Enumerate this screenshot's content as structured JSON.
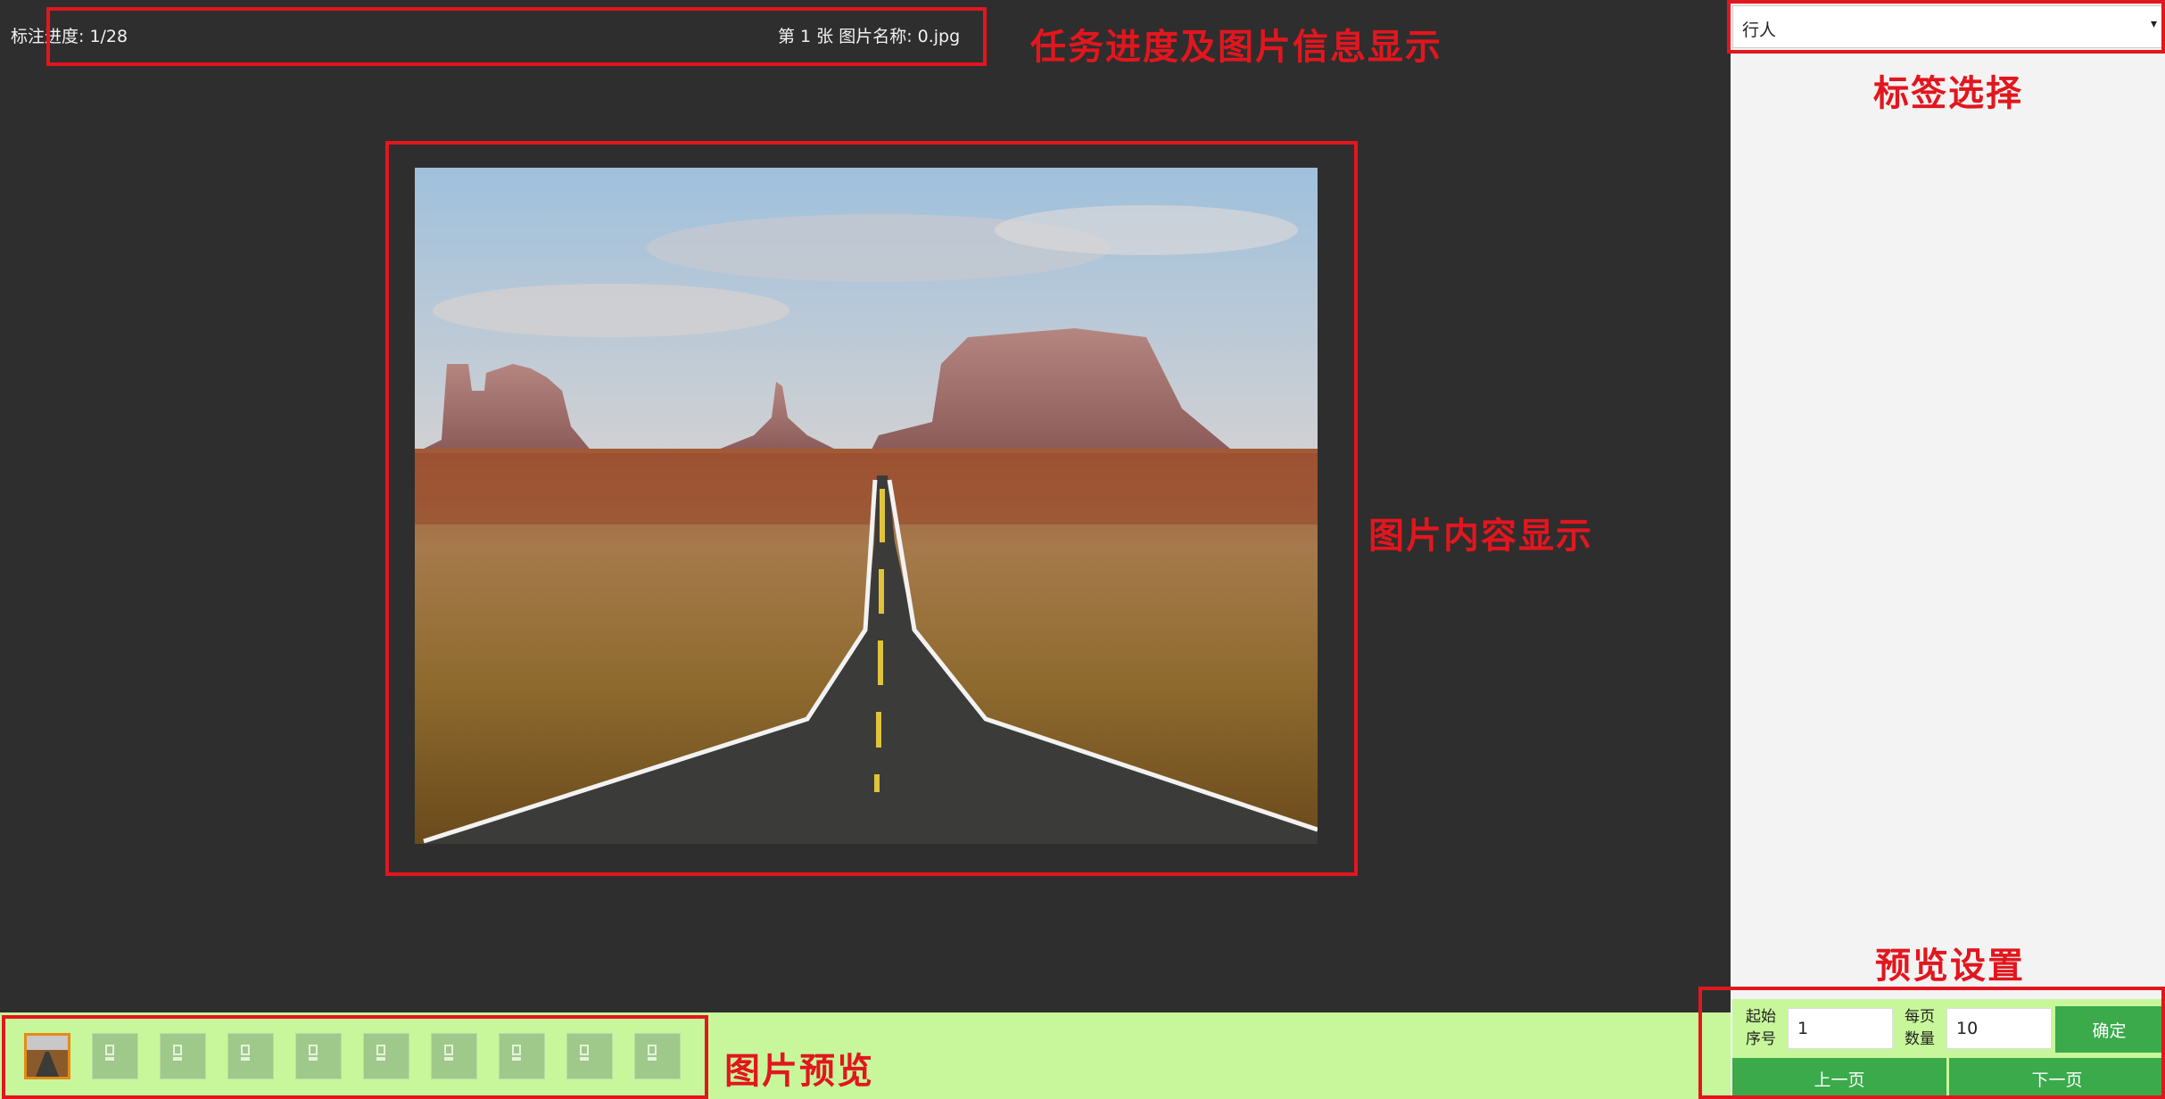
{
  "header": {
    "progress": "标注进度: 1/28",
    "image_info": "第 1 张 图片名称: 0.jpg"
  },
  "label_select": {
    "selected": "行人",
    "caret": "▾"
  },
  "preview": {
    "thumbnail_count": 10,
    "active_index": 0
  },
  "settings": {
    "start_label": "起始\n序号",
    "start_value": "1",
    "per_page_label": "每页\n数量",
    "per_page_value": "10",
    "confirm": "确定",
    "prev_page": "上一页",
    "next_page": "下一页"
  },
  "annotations": {
    "progress_info": "任务进度及图片信息显示",
    "label_select": "标签选择",
    "image_content": "图片内容显示",
    "preview_settings": "预览设置",
    "image_preview": "图片预览"
  },
  "colors": {
    "callout": "#e2161e",
    "dark_bg": "#2e2e2e",
    "preview_bg": "#c7f79a",
    "button": "#3aaa4b"
  }
}
